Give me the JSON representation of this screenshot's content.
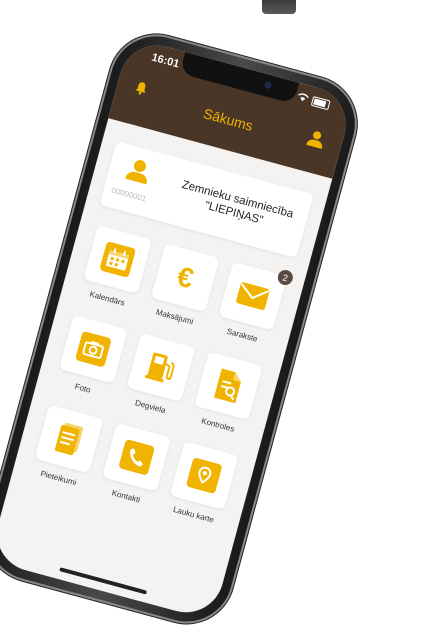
{
  "status": {
    "time": "16:01"
  },
  "header": {
    "title": "Sākums"
  },
  "account": {
    "code": "00000001",
    "name": "Zemnieku saimniecība \"LIEPIŅAS\""
  },
  "tiles": [
    {
      "label": "Kalendārs",
      "icon": "calendar-icon"
    },
    {
      "label": "Maksājumi",
      "icon": "euro-icon"
    },
    {
      "label": "Sarakste",
      "icon": "envelope-icon",
      "badge": "2"
    },
    {
      "label": "Foto",
      "icon": "camera-icon"
    },
    {
      "label": "Degviela",
      "icon": "fuel-pump-icon"
    },
    {
      "label": "Kontroles",
      "icon": "document-search-icon"
    },
    {
      "label": "Pieteikumi",
      "icon": "document-icon"
    },
    {
      "label": "Kontakti",
      "icon": "phone-icon"
    },
    {
      "label": "Lauku karte",
      "icon": "map-pin-icon"
    }
  ],
  "colors": {
    "accent": "#f0b400",
    "header": "#4a3627",
    "badge": "#5a4a44"
  }
}
